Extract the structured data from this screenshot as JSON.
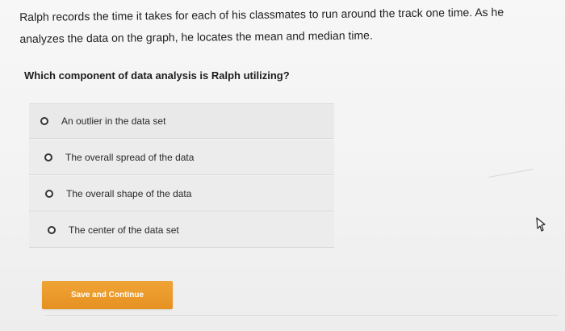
{
  "question": {
    "text": "Ralph records the time it takes for each of his classmates to run around the track one time. As he analyzes the data on the graph, he locates the mean and median time.",
    "prompt": "Which component of data analysis is Ralph utilizing?"
  },
  "options": [
    {
      "label": "An outlier in the data set"
    },
    {
      "label": "The overall spread of the data"
    },
    {
      "label": "The overall shape of the data"
    },
    {
      "label": "The center of the data set"
    }
  ],
  "actions": {
    "save_label": "Save and Continue"
  },
  "colors": {
    "accent": "#EA9A2A",
    "background": "#F4F4F4",
    "option_bg": "#ECECEC"
  },
  "icons": {
    "cursor": "pointer-cursor-icon"
  }
}
